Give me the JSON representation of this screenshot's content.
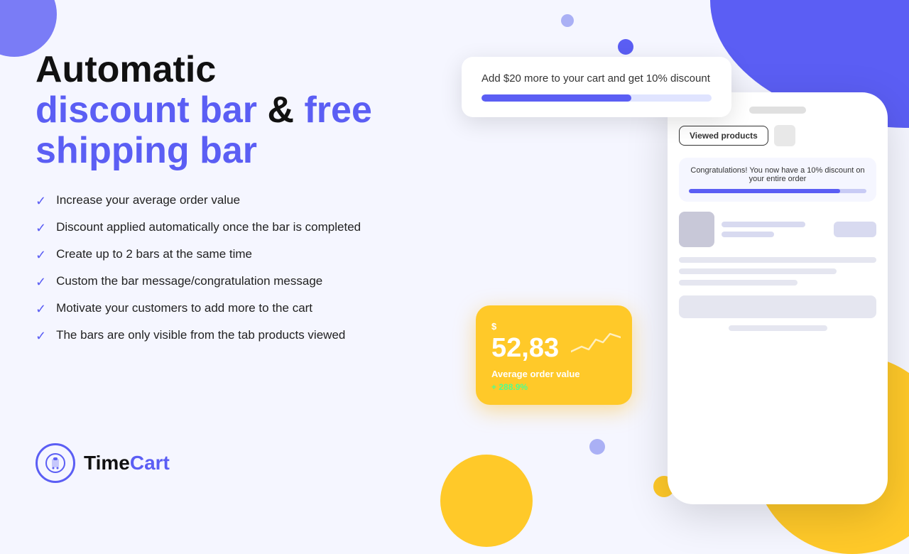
{
  "background": {
    "color": "#f5f6ff",
    "accent_purple": "#5b5ef4",
    "accent_yellow": "#ffc929"
  },
  "headline": {
    "line1": "Automatic",
    "line2_purple": "discount bar",
    "line2_ampersand": " & ",
    "line2_purple2": "free",
    "line3_purple": "shipping bar"
  },
  "features": [
    "Increase your average order value",
    "Discount applied automatically once the bar is completed",
    "Create up to 2 bars at the same time",
    "Custom the bar message/congratulation message",
    "Motivate your customers to add more to the cart",
    "The bars are only visible from the tab products viewed"
  ],
  "logo": {
    "time_text": "Time",
    "cart_text": "Cart"
  },
  "discount_card": {
    "message": "Add $20 more to your cart and get 10% discount",
    "progress_percent": 65
  },
  "viewed_products_button": {
    "label": "Viewed products"
  },
  "congrats_message": {
    "text": "Congratulations! You now have a 10% discount on your entire order",
    "progress_percent": 85
  },
  "stats_card": {
    "dollar_sign": "$",
    "amount": "52,83",
    "label": "Average order value",
    "change": "+ 288.9%"
  }
}
